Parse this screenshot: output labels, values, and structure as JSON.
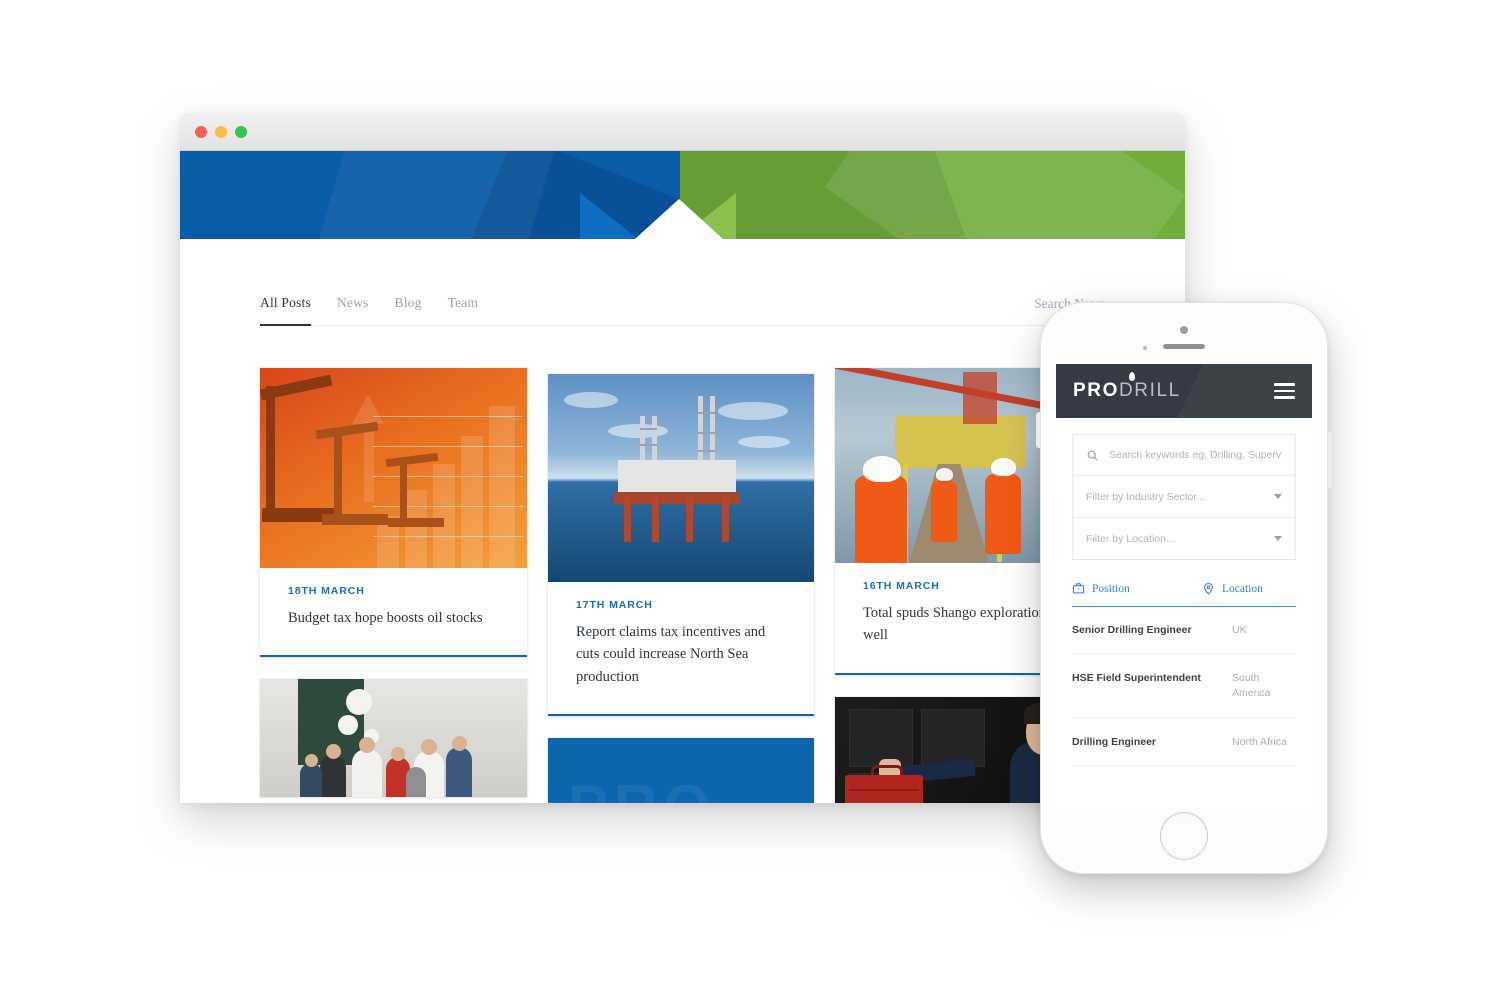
{
  "browser": {
    "window_controls": [
      "close",
      "minimize",
      "maximize"
    ],
    "hero": {
      "left_color": "#0a5ba8",
      "right_color": "#6fae3b"
    },
    "nav": {
      "tabs": [
        {
          "label": "All Posts",
          "active": true
        },
        {
          "label": "News",
          "active": false
        },
        {
          "label": "Blog",
          "active": false
        },
        {
          "label": "Team",
          "active": false
        }
      ],
      "search_label": "Search News"
    },
    "accent_color": "#1566b0",
    "cards": [
      {
        "image": "oil-pumpjack-chart-image",
        "date": "18TH MARCH",
        "title": "Budget tax hope boosts oil stocks"
      },
      {
        "image": "offshore-oil-rig-image",
        "date": "17TH MARCH",
        "title": "Report claims tax incentives and cuts could increase North Sea production"
      },
      {
        "image": "total-workers-platform-image",
        "date": "16TH MARCH",
        "title": "Total spuds Shango exploration well"
      },
      {
        "image": "team-group-photo-image",
        "date": "",
        "title": ""
      },
      {
        "image": "prodrill-blue-banner-image",
        "date": "",
        "title": ""
      },
      {
        "image": "chancellor-budget-box-image",
        "date": "",
        "title": ""
      }
    ]
  },
  "phone": {
    "logo": {
      "primary": "PRODRILL",
      "part_one": "PRO",
      "part_two": "DRILL"
    },
    "menu_label": "Menu",
    "search": {
      "placeholder": "Search keywords eg. Drilling, Supervis"
    },
    "filters": [
      {
        "label": "Filter by Industry Sector..."
      },
      {
        "label": "Filter by Location..."
      }
    ],
    "list_tabs": [
      {
        "label": "Position",
        "icon": "briefcase-icon"
      },
      {
        "label": "Location",
        "icon": "map-pin-icon"
      }
    ],
    "jobs": [
      {
        "position": "Senior Drilling Engineer",
        "location": "UK"
      },
      {
        "position": "HSE Field Superintendent",
        "location": "South America"
      },
      {
        "position": "Drilling Engineer",
        "location": "North Africa"
      }
    ],
    "header_color": "#333c44",
    "link_color": "#2f7fd0"
  }
}
